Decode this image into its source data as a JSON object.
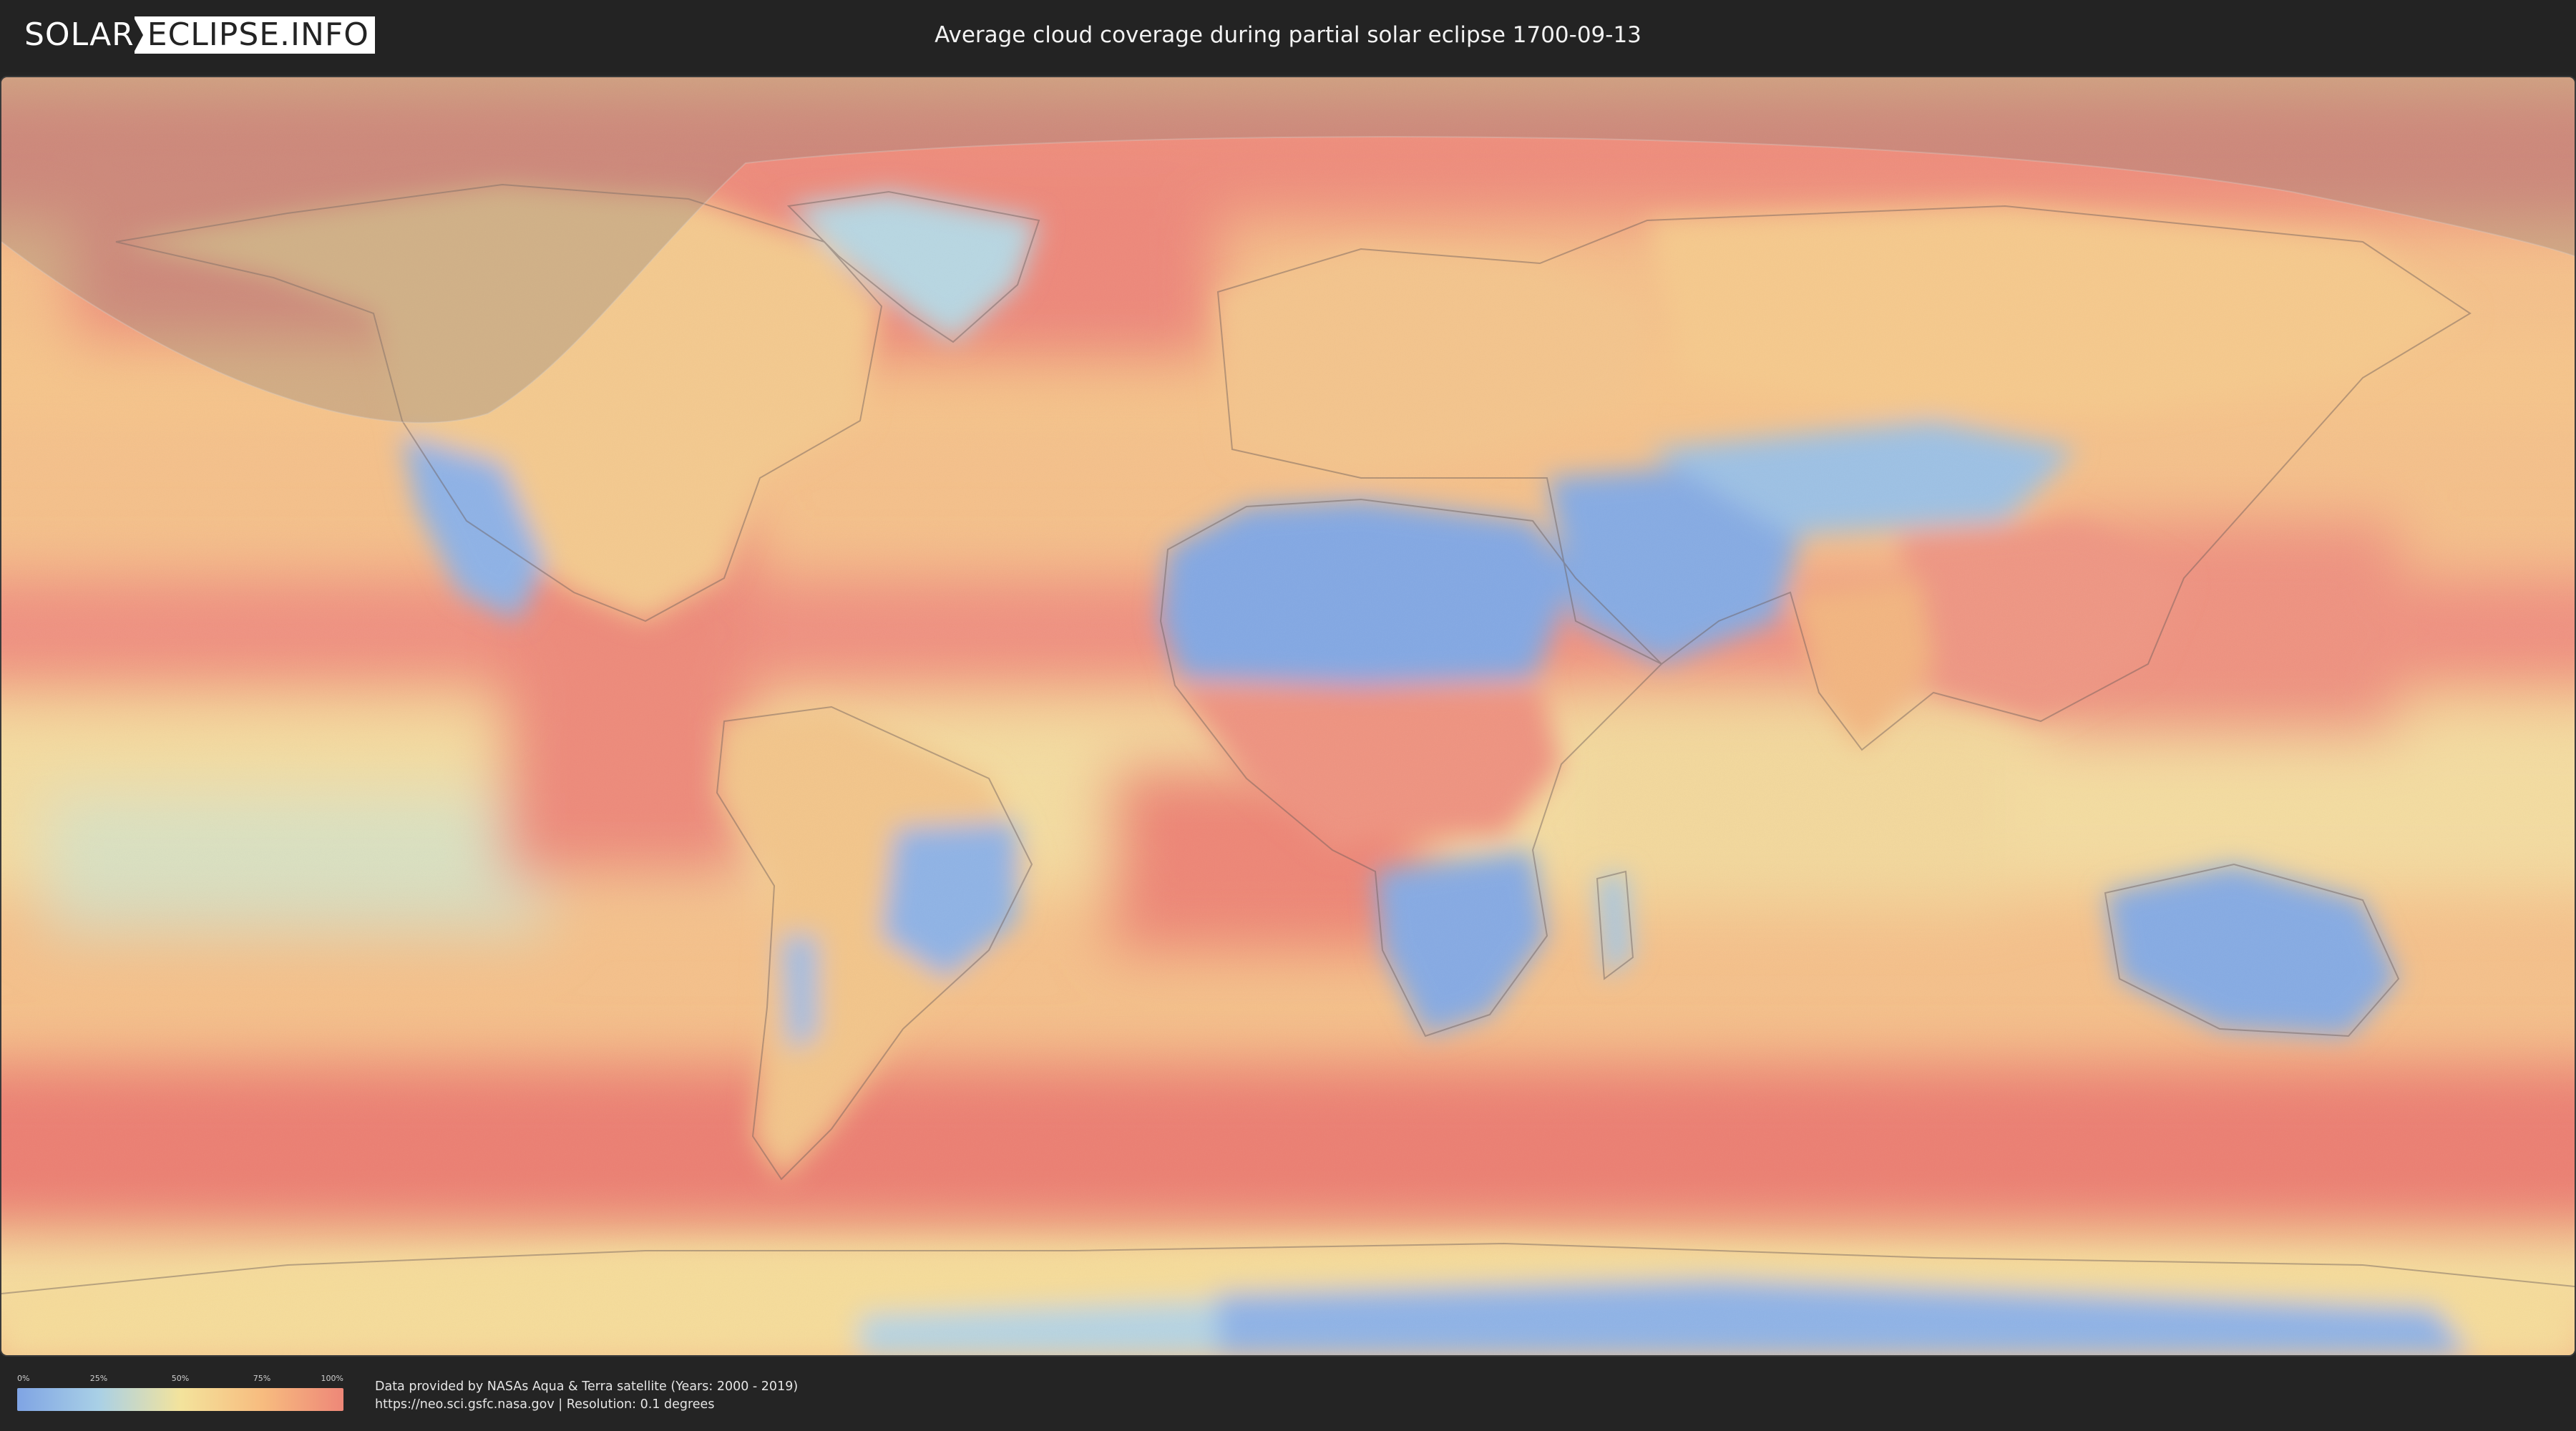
{
  "header": {
    "logo_left": "SOLAR",
    "logo_right": "ECLIPSE.INFO",
    "title": "Average cloud coverage during partial solar eclipse 1700-09-13"
  },
  "legend": {
    "ticks": [
      "0%",
      "25%",
      "50%",
      "75%",
      "100%"
    ],
    "colors": [
      "#7fa4e4",
      "#a9d0e6",
      "#f3e39c",
      "#f7bc7f",
      "#ee8778"
    ]
  },
  "footer": {
    "line1": "Data provided by NASAs Aqua & Terra satellite (Years: 2000 - 2019)",
    "line2": "https://neo.sci.gsfc.nasa.gov | Resolution: 0.1 degrees"
  },
  "map": {
    "colors": {
      "clear": "#7fa4e4",
      "low": "#a9d0e6",
      "mid": "#f3e39c",
      "high": "#f7bc7f",
      "full": "#ee8778",
      "eclipse_shade": "#8a7f78",
      "border": "#6c5e5a"
    }
  }
}
